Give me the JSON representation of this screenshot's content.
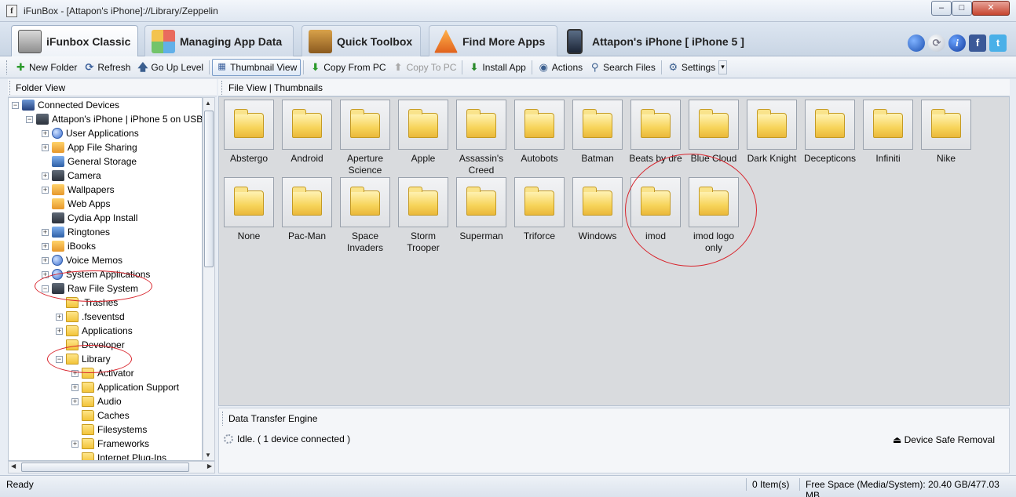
{
  "window": {
    "title": "iFunBox - [Attapon's iPhone]://Library/Zeppelin",
    "app_icon": "iFunBox",
    "minimize": "–",
    "maximize": "□",
    "close": "✕"
  },
  "tabs": [
    {
      "label": "iFunbox Classic",
      "icon": "fun-box-icon",
      "active": true
    },
    {
      "label": "Managing App Data",
      "icon": "grid-icon",
      "active": false
    },
    {
      "label": "Quick Toolbox",
      "icon": "toolbox-icon",
      "active": false
    },
    {
      "label": "Find More Apps",
      "icon": "appstore-icon",
      "active": false
    }
  ],
  "device": {
    "label": "Attapon's iPhone [ iPhone 5 ]"
  },
  "top_icons": {
    "info": "i",
    "facebook": "f",
    "twitter": "t"
  },
  "toolbar": {
    "new_folder": "New Folder",
    "refresh": "Refresh",
    "go_up": "Go Up Level",
    "thumbnail_view": "Thumbnail View",
    "copy_from_pc": "Copy From PC",
    "copy_to_pc": "Copy To PC",
    "install_app": "Install App",
    "actions": "Actions",
    "search_files": "Search Files",
    "settings": "Settings"
  },
  "left_panel": {
    "header": "Folder View"
  },
  "tree": [
    {
      "label": "Connected Devices",
      "depth": 0,
      "expander": "−",
      "icon": "pc"
    },
    {
      "label": "Attapon's iPhone | iPhone 5 on USB",
      "depth": 1,
      "expander": "−",
      "icon": "dark"
    },
    {
      "label": "User Applications",
      "depth": 2,
      "expander": "+",
      "icon": "globe"
    },
    {
      "label": "App File Sharing",
      "depth": 2,
      "expander": "+",
      "icon": "gold"
    },
    {
      "label": "General Storage",
      "depth": 2,
      "expander": "",
      "icon": "blue"
    },
    {
      "label": "Camera",
      "depth": 2,
      "expander": "+",
      "icon": "dark"
    },
    {
      "label": "Wallpapers",
      "depth": 2,
      "expander": "+",
      "icon": "gold"
    },
    {
      "label": "Web Apps",
      "depth": 2,
      "expander": "",
      "icon": "gold"
    },
    {
      "label": "Cydia App Install",
      "depth": 2,
      "expander": "",
      "icon": "dark"
    },
    {
      "label": "Ringtones",
      "depth": 2,
      "expander": "+",
      "icon": "blue"
    },
    {
      "label": "iBooks",
      "depth": 2,
      "expander": "+",
      "icon": "gold"
    },
    {
      "label": "Voice Memos",
      "depth": 2,
      "expander": "+",
      "icon": "globe"
    },
    {
      "label": "System Applications",
      "depth": 2,
      "expander": "+",
      "icon": "globe"
    },
    {
      "label": "Raw File System",
      "depth": 2,
      "expander": "−",
      "icon": "dark"
    },
    {
      "label": ".Trashes",
      "depth": 3,
      "expander": "",
      "icon": "folder"
    },
    {
      "label": ".fseventsd",
      "depth": 3,
      "expander": "+",
      "icon": "folder"
    },
    {
      "label": "Applications",
      "depth": 3,
      "expander": "+",
      "icon": "folder"
    },
    {
      "label": "Developer",
      "depth": 3,
      "expander": "",
      "icon": "folder"
    },
    {
      "label": "Library",
      "depth": 3,
      "expander": "−",
      "icon": "folder"
    },
    {
      "label": "Activator",
      "depth": 4,
      "expander": "+",
      "icon": "folder"
    },
    {
      "label": "Application Support",
      "depth": 4,
      "expander": "+",
      "icon": "folder"
    },
    {
      "label": "Audio",
      "depth": 4,
      "expander": "+",
      "icon": "folder"
    },
    {
      "label": "Caches",
      "depth": 4,
      "expander": "",
      "icon": "folder"
    },
    {
      "label": "Filesystems",
      "depth": 4,
      "expander": "",
      "icon": "folder"
    },
    {
      "label": "Frameworks",
      "depth": 4,
      "expander": "+",
      "icon": "folder"
    },
    {
      "label": "Internet Plug-Ins",
      "depth": 4,
      "expander": "",
      "icon": "folder"
    }
  ],
  "right_panel": {
    "header": "File View  |  Thumbnails"
  },
  "files": [
    {
      "name": "Abstergo"
    },
    {
      "name": "Android"
    },
    {
      "name": "Aperture Science"
    },
    {
      "name": "Apple"
    },
    {
      "name": "Assassin's Creed"
    },
    {
      "name": "Autobots"
    },
    {
      "name": "Batman"
    },
    {
      "name": "Beats by dre"
    },
    {
      "name": "Blue Cloud"
    },
    {
      "name": "Dark Knight"
    },
    {
      "name": "Decepticons"
    },
    {
      "name": "Infiniti"
    },
    {
      "name": "Nike"
    },
    {
      "name": "None"
    },
    {
      "name": "Pac-Man"
    },
    {
      "name": "Space Invaders"
    },
    {
      "name": "Storm Trooper"
    },
    {
      "name": "Superman"
    },
    {
      "name": "Triforce"
    },
    {
      "name": "Windows"
    },
    {
      "name": "imod"
    },
    {
      "name": "imod logo only"
    }
  ],
  "transfer": {
    "header": "Data Transfer Engine",
    "status": "Idle.  ( 1 device connected )",
    "safe_removal": "Device Safe Removal"
  },
  "statusbar": {
    "ready": "Ready",
    "items": "0 Item(s)",
    "free_space": "Free Space (Media/System): 20.40 GB/477.03 MB"
  },
  "colors": {
    "annotation": "#d8222a",
    "accent": "#7a9cc8"
  }
}
